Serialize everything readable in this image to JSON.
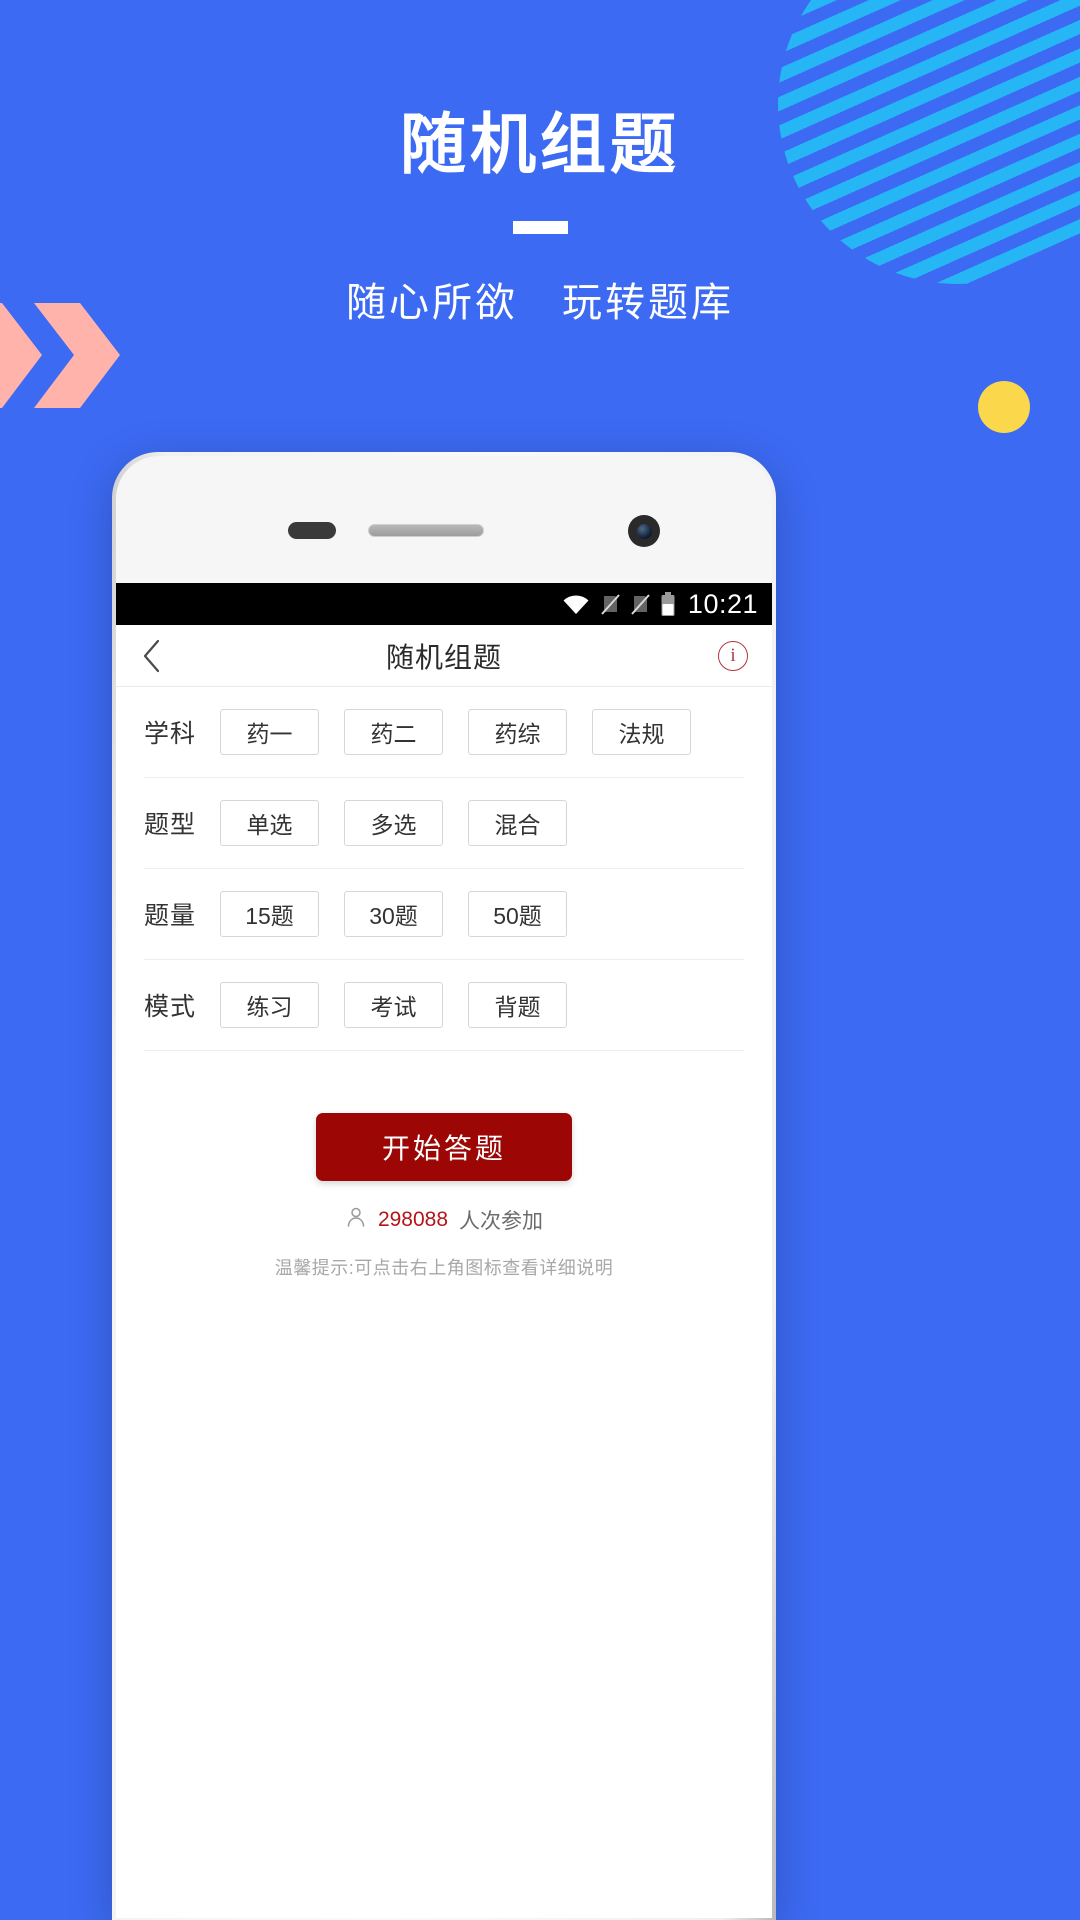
{
  "hero": {
    "title": "随机组题",
    "subtitle_left": "随心所欲",
    "subtitle_right": "玩转题库"
  },
  "colors": {
    "background": "#3c6af3",
    "stripe": "#26b6f5",
    "chevron": "#ffb3ab",
    "dot": "#fbd84b",
    "cta": "#9c0705",
    "accent_red": "#b3151a"
  },
  "phone": {
    "statusbar": {
      "time": "10:21",
      "icons": [
        "wifi-icon",
        "sim-no-signal-icon",
        "sim-no-signal-icon",
        "battery-icon"
      ]
    },
    "appbar": {
      "back_icon": "chevron-left-icon",
      "title": "随机组题",
      "info_icon": "info-circle-icon",
      "info_label": "i"
    },
    "rows": [
      {
        "label": "学科",
        "options": [
          "药一",
          "药二",
          "药综",
          "法规"
        ]
      },
      {
        "label": "题型",
        "options": [
          "单选",
          "多选",
          "混合"
        ]
      },
      {
        "label": "题量",
        "options": [
          "15题",
          "30题",
          "50题"
        ]
      },
      {
        "label": "模式",
        "options": [
          "练习",
          "考试",
          "背题"
        ]
      }
    ],
    "cta": {
      "label": "开始答题"
    },
    "joined": {
      "icon": "person-icon",
      "count": "298088",
      "suffix": "人次参加"
    },
    "tip": "温馨提示:可点击右上角图标查看详细说明"
  }
}
